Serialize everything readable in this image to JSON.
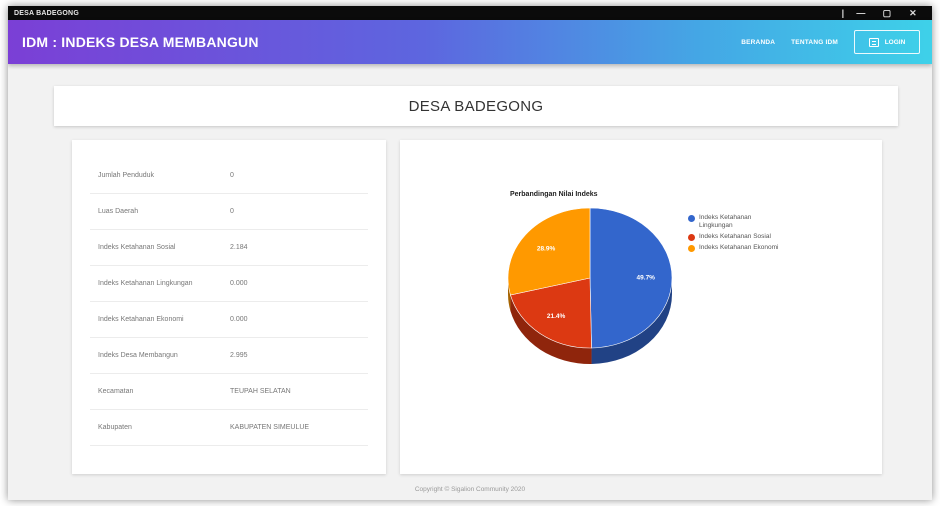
{
  "window": {
    "title": "DESA BADEGONG",
    "controls": {
      "minimize": "—",
      "maximize": "▢",
      "close": "✕",
      "separator": "|"
    }
  },
  "appbar": {
    "brand": "IDM : INDEKS DESA MEMBANGUN",
    "nav": {
      "home": "BERANDA",
      "about": "TENTANG IDM"
    },
    "login_label": "LOGIN"
  },
  "header": {
    "village": "DESA BADEGONG"
  },
  "info": {
    "rows": [
      {
        "label": "Jumlah Penduduk",
        "value": "0"
      },
      {
        "label": "Luas Daerah",
        "value": "0"
      },
      {
        "label": "Indeks Ketahanan Sosial",
        "value": "2.184"
      },
      {
        "label": "Indeks Ketahanan Lingkungan",
        "value": "0.000"
      },
      {
        "label": "Indeks Ketahanan Ekonomi",
        "value": "0.000"
      },
      {
        "label": "Indeks Desa Membangun",
        "value": "2.995"
      },
      {
        "label": "Kecamatan",
        "value": "TEUPAH SELATAN"
      },
      {
        "label": "Kabupaten",
        "value": "KABUPATEN SIMEULUE"
      }
    ]
  },
  "chart_data": {
    "type": "pie",
    "title": "Perbandingan Nilai Indeks",
    "legend_position": "right",
    "slices": [
      {
        "label": "Indeks Ketahanan Lingkungan",
        "value": 49.7,
        "display": "49.7%",
        "color": "#3366cc"
      },
      {
        "label": "Indeks Ketahanan Sosial",
        "value": 21.4,
        "display": "21.4%",
        "color": "#dc3912"
      },
      {
        "label": "Indeks Ketahanan Ekonomi",
        "value": 28.9,
        "display": "28.9%",
        "color": "#ff9900"
      }
    ]
  },
  "footer": {
    "text": "Copyright © Sigalion Community 2020"
  }
}
